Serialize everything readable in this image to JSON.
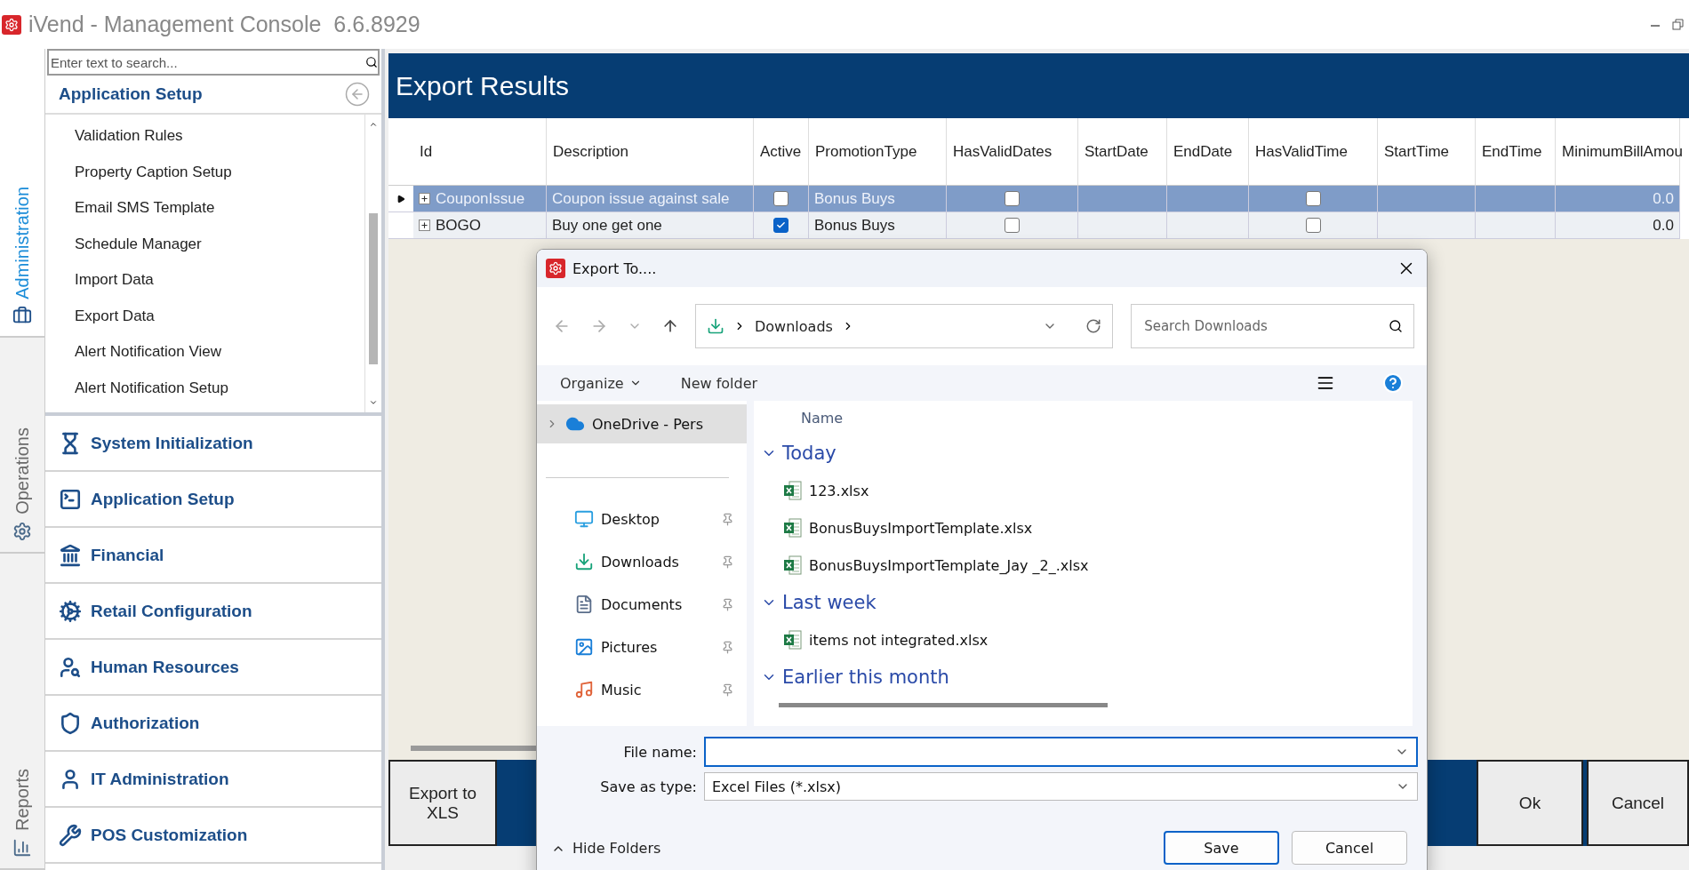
{
  "window": {
    "title": "iVend - Management Console",
    "version": "6.6.8929"
  },
  "side_tabs": [
    {
      "label": "Administration",
      "selected": true
    },
    {
      "label": "Operations",
      "selected": false
    },
    {
      "label": "Reports",
      "selected": false
    }
  ],
  "sidebar": {
    "search": {
      "placeholder": "Enter text to search..."
    },
    "section_title": "Application Setup",
    "items": [
      "Validation Rules",
      "Property Caption Setup",
      "Email SMS Template",
      "Schedule Manager",
      "Import Data",
      "Export Data",
      "Alert Notification View",
      "Alert Notification Setup"
    ],
    "groups": [
      "System Initialization",
      "Application Setup",
      "Financial",
      "Retail Configuration",
      "Human Resources",
      "Authorization",
      "IT Administration",
      "POS Customization"
    ]
  },
  "main": {
    "title": "Export Results",
    "table": {
      "columns": [
        "Id",
        "Description",
        "Active",
        "PromotionType",
        "HasValidDates",
        "StartDate",
        "EndDate",
        "HasValidTime",
        "StartTime",
        "EndTime",
        "MinimumBillAmou"
      ],
      "rows": [
        {
          "selected": true,
          "cells": [
            {
              "kind": "text",
              "text": "CouponIssue"
            },
            {
              "kind": "text",
              "text": "Coupon issue against sale"
            },
            {
              "kind": "check",
              "checked": false
            },
            {
              "kind": "text",
              "text": "Bonus Buys"
            },
            {
              "kind": "check",
              "checked": false
            },
            {
              "kind": "text",
              "text": ""
            },
            {
              "kind": "text",
              "text": ""
            },
            {
              "kind": "check",
              "checked": false
            },
            {
              "kind": "text",
              "text": ""
            },
            {
              "kind": "text",
              "text": ""
            },
            {
              "kind": "num",
              "text": "0.0"
            }
          ]
        },
        {
          "selected": false,
          "cells": [
            {
              "kind": "text",
              "text": "BOGO"
            },
            {
              "kind": "text",
              "text": "Buy one get one"
            },
            {
              "kind": "check",
              "checked": true
            },
            {
              "kind": "text",
              "text": "Bonus Buys"
            },
            {
              "kind": "check",
              "checked": false
            },
            {
              "kind": "text",
              "text": ""
            },
            {
              "kind": "text",
              "text": ""
            },
            {
              "kind": "check",
              "checked": false
            },
            {
              "kind": "text",
              "text": ""
            },
            {
              "kind": "text",
              "text": ""
            },
            {
              "kind": "num",
              "text": "0.0"
            }
          ]
        }
      ]
    },
    "buttons": {
      "export": "Export to XLS",
      "ok": "Ok",
      "cancel": "Cancel"
    }
  },
  "dialog": {
    "title": "Export To....",
    "path": "Downloads",
    "search": {
      "placeholder": "Search Downloads"
    },
    "toolbar": {
      "organize": "Organize",
      "new_folder": "New folder"
    },
    "nav": [
      {
        "label": "OneDrive - Pers",
        "kind": "root",
        "selected": true
      },
      {
        "label": "Desktop",
        "kind": "quick",
        "selected": false
      },
      {
        "label": "Downloads",
        "kind": "quick",
        "selected": false
      },
      {
        "label": "Documents",
        "kind": "quick",
        "selected": false
      },
      {
        "label": "Pictures",
        "kind": "quick",
        "selected": false
      },
      {
        "label": "Music",
        "kind": "quick",
        "selected": false
      }
    ],
    "column": "Name",
    "groups": [
      {
        "label": "Today",
        "expanded": true,
        "files": [
          "123.xlsx",
          "BonusBuysImportTemplate.xlsx",
          "BonusBuysImportTemplate_Jay _2_.xlsx"
        ]
      },
      {
        "label": "Last week",
        "expanded": true,
        "files": [
          "items not integrated.xlsx"
        ]
      },
      {
        "label": "Earlier this month",
        "expanded": true
      }
    ],
    "file_name_label": "File name:",
    "save_type_label": "Save as type:",
    "save_type": "Excel Files (*.xlsx)",
    "hide_folders": "Hide Folders",
    "save": "Save",
    "cancel": "Cancel"
  }
}
